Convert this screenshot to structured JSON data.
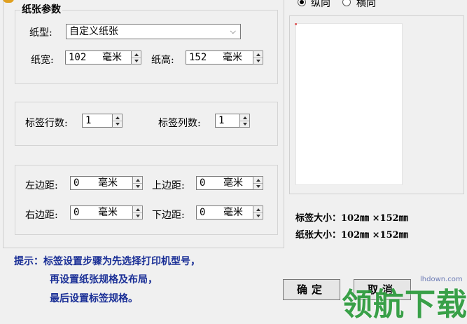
{
  "paper": {
    "group_title": "纸张参数",
    "type_label": "纸型:",
    "type_value": "自定义纸张",
    "width_label": "纸宽:",
    "width_value": "102",
    "height_label": "纸高:",
    "height_value": "152",
    "unit": "毫米"
  },
  "label_grid": {
    "rows_label": "标签行数:",
    "rows_value": "1",
    "cols_label": "标签列数:",
    "cols_value": "1"
  },
  "margins": {
    "left_label": "左边距:",
    "left_value": "0",
    "top_label": "上边距:",
    "top_value": "0",
    "right_label": "右边距:",
    "right_value": "0",
    "bottom_label": "下边距:",
    "bottom_value": "0",
    "unit": "毫米"
  },
  "orientation": {
    "portrait_label": "纵向",
    "landscape_label": "横向",
    "selected": "portrait"
  },
  "info": {
    "label_size": "标签大小：102㎜ ×152㎜",
    "paper_size": "纸张大小：102㎜ ×152㎜"
  },
  "tips": {
    "line1": "提示：标签设置步骤为先选择打印机型号，",
    "line2": "再设置纸张规格及布局，",
    "line3": "最后设置标签规格。"
  },
  "buttons": {
    "ok": "确定",
    "cancel": "取消"
  },
  "watermark": {
    "text": "领航下载",
    "url": "lhdown.com"
  },
  "colors": {
    "tip_text": "#1a2f96",
    "watermark_green": "#2a9a3a",
    "watermark_blue": "#2f6fcf"
  }
}
